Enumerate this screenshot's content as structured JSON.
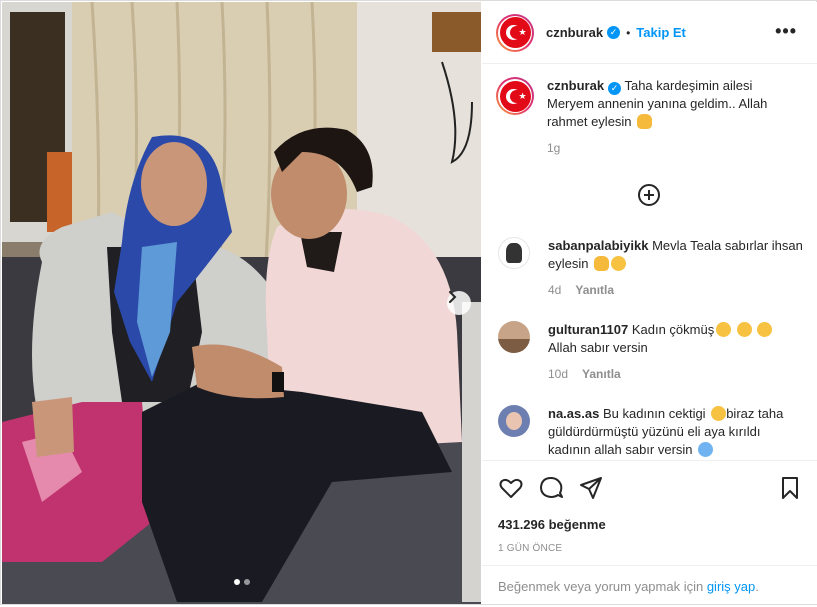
{
  "post": {
    "username": "cznburak",
    "follow_label": "Takip Et",
    "separator": "•",
    "more_label": "•••",
    "caption": "Taha kardeşimin ailesi Meryem annenin yanına geldim.. Allah rahmet eylesin",
    "caption_time": "1g",
    "likes": "431.296 beğenme",
    "date": "1 GÜN ÖNCE",
    "carousel_count": 2,
    "carousel_active": 1
  },
  "comments": [
    {
      "username": "sabanpalabiyikk",
      "text": "Mevla Teala sabırlar ihsan eylesin",
      "time": "4d",
      "reply": "Yanıtla"
    },
    {
      "username": "gulturan1107",
      "text": "Kadın çökmüş",
      "text2": "Allah sabır versin",
      "time": "10d",
      "reply": "Yanıtla"
    },
    {
      "username": "na.as.as",
      "text": "Bu kadının cektigi",
      "text2": "biraz taha güldürdürmüştü yüzünü eli aya kırıldı kadının allah sabır versin"
    }
  ],
  "login_bar": {
    "prefix": "Beğenmek veya yorum yapmak için",
    "link": "giriş yap",
    "suffix": "."
  },
  "icons": [
    "heart-icon",
    "comment-icon",
    "share-icon",
    "bookmark-icon",
    "plus-circle-icon",
    "chevron-right-icon",
    "verified-icon"
  ],
  "colors": {
    "accent": "#0095f6",
    "flag_red": "#e30a17",
    "text": "#262626",
    "muted": "#8e8e8e"
  }
}
